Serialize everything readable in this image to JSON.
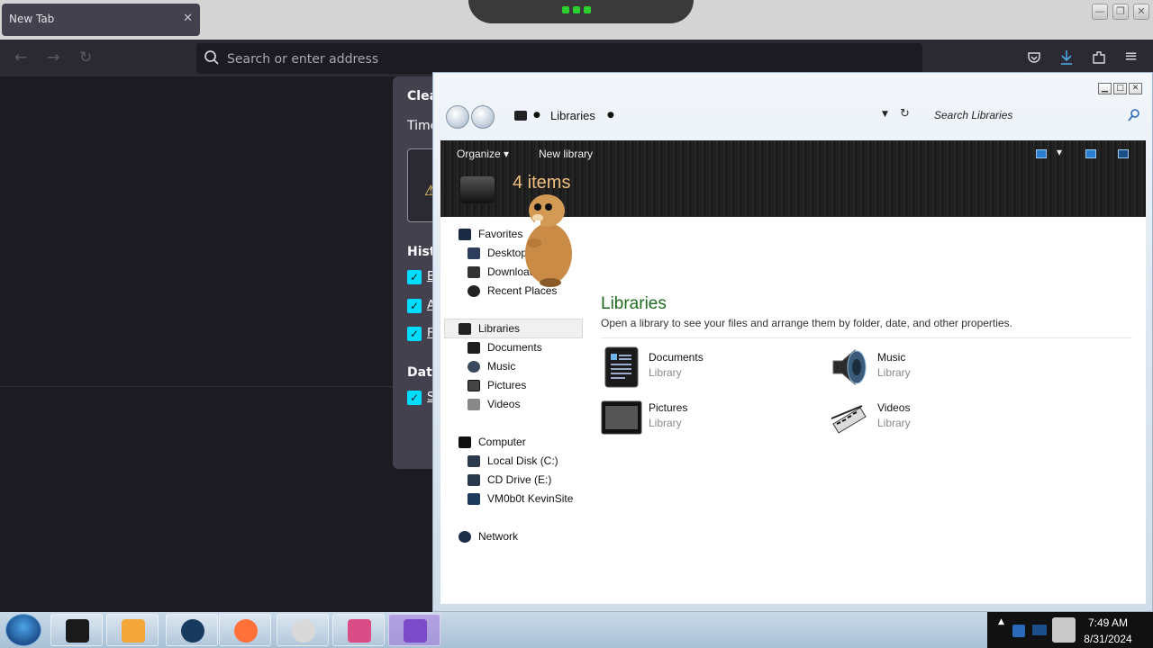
{
  "browser": {
    "tab": {
      "title": "New Tab",
      "close": "✕"
    },
    "urlbar": {
      "placeholder": "Search or enter address"
    },
    "nav": {
      "back": "←",
      "forward": "→",
      "reload": "↻"
    },
    "tools": {
      "menu": "≡"
    },
    "window_controls": {
      "minimize": "—",
      "maximize": "❐",
      "close": "✕"
    }
  },
  "clear_history_dialog": {
    "title": "Clea",
    "time_label": "Time",
    "warning": "⚠",
    "history_label": "Histo",
    "checkboxes": [
      "B",
      "A",
      "F"
    ],
    "data_label": "Data",
    "data_checkboxes": [
      "S"
    ]
  },
  "explorer": {
    "window_controls": {
      "minimize": "▁",
      "maximize": "□",
      "close": "✕"
    },
    "breadcrumb": {
      "separator": "●",
      "location": "Libraries"
    },
    "dropdown": "▼",
    "refresh": "↻",
    "search_placeholder": "Search Libraries",
    "toolbar": {
      "organize": "Organize ▾",
      "new_library": "New library",
      "items_count": "4 items",
      "view_dropdown": "▾"
    },
    "nav_pane": {
      "favorites": {
        "label": "Favorites",
        "items": [
          "Desktop",
          "Downloads",
          "Recent Places"
        ]
      },
      "libraries": {
        "label": "Libraries",
        "items": [
          "Documents",
          "Music",
          "Pictures",
          "Videos"
        ]
      },
      "computer": {
        "label": "Computer",
        "items": [
          "Local Disk (C:)",
          "CD Drive (E:)",
          "VM0b0t KevinSite"
        ]
      },
      "network": {
        "label": "Network"
      }
    },
    "main": {
      "title": "Libraries",
      "description": "Open a library to see your files and arrange them by folder, date, and other properties.",
      "libraries": [
        {
          "name": "Documents",
          "type": "Library"
        },
        {
          "name": "Music",
          "type": "Library"
        },
        {
          "name": "Pictures",
          "type": "Library"
        },
        {
          "name": "Videos",
          "type": "Library"
        }
      ]
    }
  },
  "taskbar": {
    "time": "7:49 AM",
    "date": "8/31/2024",
    "tray_arrow": "▲"
  },
  "colors": {
    "firefox_bg": "#1c1b22",
    "library_title": "#1e6b1e",
    "accent_check": "#00ddff"
  }
}
